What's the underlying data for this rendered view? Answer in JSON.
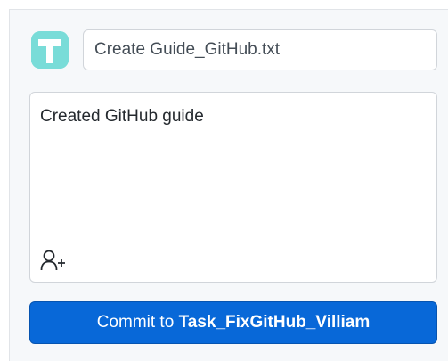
{
  "commit": {
    "summary_value": "Create Guide_GitHub.txt",
    "description_value": "Created GitHub guide",
    "button_prefix": "Commit to ",
    "branch_name": "Task_FixGitHub_Villiam"
  },
  "icons": {
    "avatar": "user-avatar-letter-T",
    "coauthor": "add-coauthor-icon"
  },
  "colors": {
    "commit_button": "#0868d8",
    "avatar_background": "#79dcd8",
    "panel_background": "#f6f8fa"
  }
}
